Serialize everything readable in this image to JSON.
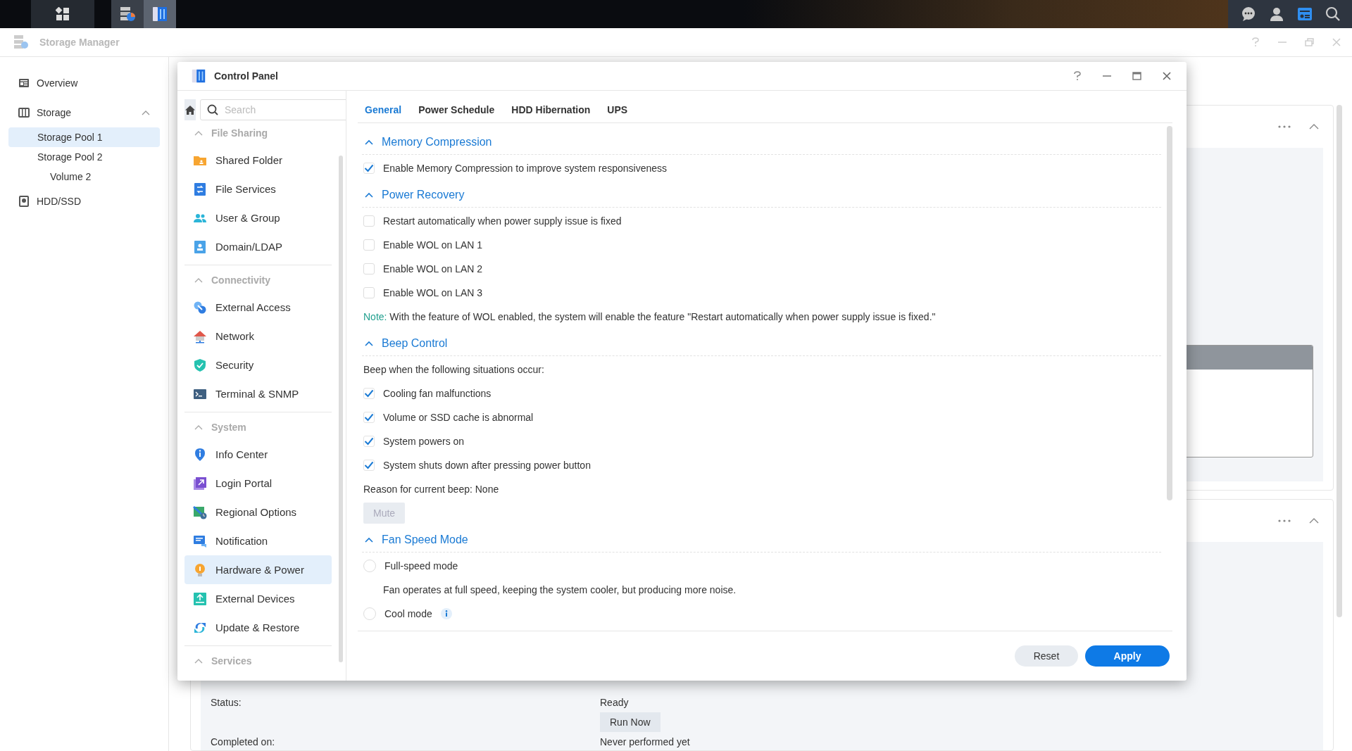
{
  "taskbar": {
    "apps": [
      {
        "selected": false
      },
      {
        "selected": true
      }
    ]
  },
  "storage_manager": {
    "title": "Storage Manager",
    "sidebar": [
      {
        "label": "Overview",
        "selected": false
      },
      {
        "label": "Storage",
        "selected": false,
        "expanded": true,
        "children": [
          {
            "label": "Storage Pool 1",
            "selected": true
          },
          {
            "label": "Storage Pool 2",
            "selected": false,
            "children": [
              {
                "label": "Volume 2",
                "selected": false
              }
            ]
          }
        ]
      },
      {
        "label": "HDD/SSD",
        "selected": false
      }
    ],
    "job": {
      "status_label": "Status:",
      "status_value": "Ready",
      "run_button": "Run Now",
      "completed_label": "Completed on:",
      "completed_value": "Never performed yet"
    }
  },
  "control_panel": {
    "title": "Control Panel",
    "search": {
      "placeholder": "Search"
    },
    "nav": [
      {
        "heading": "File Sharing",
        "expanded": true,
        "items": [
          {
            "label": "Shared Folder",
            "selected": false
          },
          {
            "label": "File Services",
            "selected": false
          },
          {
            "label": "User & Group",
            "selected": false
          },
          {
            "label": "Domain/LDAP",
            "selected": false
          }
        ]
      },
      {
        "heading": "Connectivity",
        "expanded": true,
        "items": [
          {
            "label": "External Access",
            "selected": false
          },
          {
            "label": "Network",
            "selected": false
          },
          {
            "label": "Security",
            "selected": false
          },
          {
            "label": "Terminal & SNMP",
            "selected": false
          }
        ]
      },
      {
        "heading": "System",
        "expanded": true,
        "items": [
          {
            "label": "Info Center",
            "selected": false
          },
          {
            "label": "Login Portal",
            "selected": false
          },
          {
            "label": "Regional Options",
            "selected": false
          },
          {
            "label": "Notification",
            "selected": false
          },
          {
            "label": "Hardware & Power",
            "selected": true
          },
          {
            "label": "External Devices",
            "selected": false
          },
          {
            "label": "Update & Restore",
            "selected": false
          }
        ]
      },
      {
        "heading": "Services",
        "expanded": true
      }
    ],
    "tabs": [
      {
        "label": "General",
        "selected": true
      },
      {
        "label": "Power Schedule",
        "selected": false
      },
      {
        "label": "HDD Hibernation",
        "selected": false
      },
      {
        "label": "UPS",
        "selected": false
      }
    ],
    "sections": [
      {
        "title": "Memory Compression",
        "expanded": true,
        "rows": [
          {
            "kind": "checkbox",
            "label": "Enable Memory Compression to improve system responsiveness",
            "checked": true
          }
        ]
      },
      {
        "title": "Power Recovery",
        "expanded": true,
        "rows": [
          {
            "kind": "checkbox",
            "label": "Restart automatically when power supply issue is fixed",
            "checked": false
          },
          {
            "kind": "checkbox",
            "label": "Enable WOL on LAN 1",
            "checked": false
          },
          {
            "kind": "checkbox",
            "label": "Enable WOL on LAN 2",
            "checked": false
          },
          {
            "kind": "checkbox",
            "label": "Enable WOL on LAN 3",
            "checked": false
          },
          {
            "kind": "note",
            "prefix": "Note:",
            "text": "With the feature of WOL enabled, the system will enable the feature \"Restart automatically when power supply issue is fixed.\""
          }
        ]
      },
      {
        "title": "Beep Control",
        "expanded": true,
        "rows": [
          {
            "kind": "text",
            "text": "Beep when the following situations occur:"
          },
          {
            "kind": "checkbox",
            "label": "Cooling fan malfunctions",
            "checked": true
          },
          {
            "kind": "checkbox",
            "label": "Volume or SSD cache is abnormal",
            "checked": true
          },
          {
            "kind": "checkbox",
            "label": "System powers on",
            "checked": true
          },
          {
            "kind": "checkbox",
            "label": "System shuts down after pressing power button",
            "checked": true
          },
          {
            "kind": "text",
            "text": "Reason for current beep: None"
          },
          {
            "kind": "button",
            "label": "Mute",
            "disabled": true
          }
        ]
      },
      {
        "title": "Fan Speed Mode",
        "expanded": true,
        "rows": [
          {
            "kind": "radio",
            "label": "Full-speed mode",
            "selected": false,
            "info": false
          },
          {
            "kind": "hint",
            "text": "Fan operates at full speed, keeping the system cooler, but producing more noise."
          },
          {
            "kind": "radio",
            "label": "Cool mode",
            "selected": false,
            "info": true
          }
        ]
      }
    ],
    "buttons": [
      {
        "label": "Reset",
        "kind": "secondary"
      },
      {
        "label": "Apply",
        "kind": "primary"
      }
    ]
  }
}
